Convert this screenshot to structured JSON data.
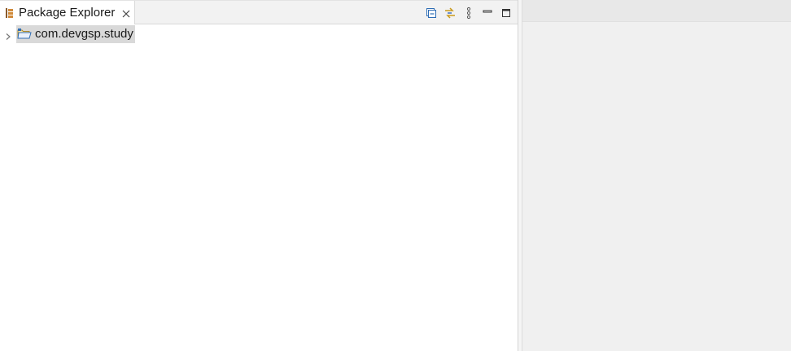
{
  "package_explorer": {
    "tab": {
      "label": "Package Explorer",
      "icon": "package-explorer-icon",
      "close_icon": "close-icon"
    },
    "toolbar": [
      {
        "name": "collapse-all-icon"
      },
      {
        "name": "link-with-editor-icon"
      },
      {
        "name": "view-menu-icon"
      },
      {
        "name": "minimize-icon"
      },
      {
        "name": "maximize-icon"
      }
    ],
    "tree": [
      {
        "label": "com.devgsp.study",
        "icon": "project-folder-icon",
        "expanded": false,
        "selected": true
      }
    ]
  },
  "colors": {
    "selection": "#d9d9d9",
    "tab_bar": "#f2f2f2",
    "right_panel": "#f0f0f0",
    "accent_blue": "#2f6db5",
    "accent_gold": "#c99a1c"
  }
}
